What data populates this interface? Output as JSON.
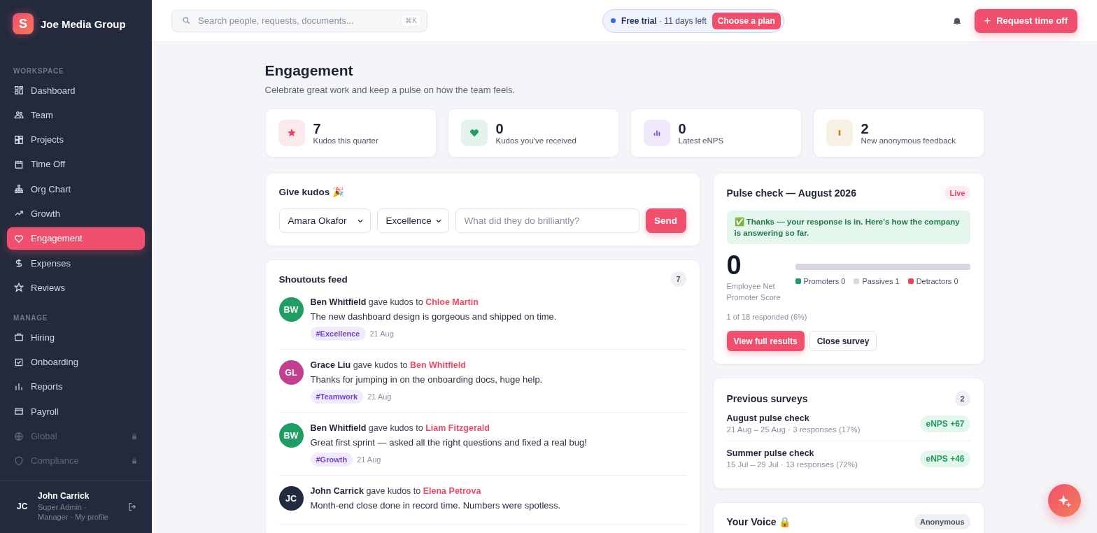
{
  "brand": {
    "logo": "S",
    "name": "Joe Media Group"
  },
  "sidebar": {
    "sections": [
      {
        "title": "WORKSPACE",
        "items": [
          {
            "label": "Dashboard",
            "selected": false,
            "locked": false
          },
          {
            "label": "Team",
            "selected": false,
            "locked": false
          },
          {
            "label": "Projects",
            "selected": false,
            "locked": false
          },
          {
            "label": "Time Off",
            "selected": false,
            "locked": false
          },
          {
            "label": "Org Chart",
            "selected": false,
            "locked": false
          },
          {
            "label": "Growth",
            "selected": false,
            "locked": false
          },
          {
            "label": "Engagement",
            "selected": true,
            "locked": false
          },
          {
            "label": "Expenses",
            "selected": false,
            "locked": false
          },
          {
            "label": "Reviews",
            "selected": false,
            "locked": false
          }
        ]
      },
      {
        "title": "MANAGE",
        "items": [
          {
            "label": "Hiring",
            "selected": false,
            "locked": false
          },
          {
            "label": "Onboarding",
            "selected": false,
            "locked": false
          },
          {
            "label": "Reports",
            "selected": false,
            "locked": false
          },
          {
            "label": "Payroll",
            "selected": false,
            "locked": false
          },
          {
            "label": "Global",
            "selected": false,
            "locked": true
          },
          {
            "label": "Compliance",
            "selected": false,
            "locked": true
          }
        ]
      }
    ],
    "user": {
      "initials": "JC",
      "name": "John Carrick",
      "role": "Super Admin ·",
      "role_2": "Manager · My profile"
    }
  },
  "topbar": {
    "search": {
      "placeholder": "Search people, requests, documents...",
      "shortcut": "⌘K"
    },
    "trial": {
      "label": "Free trial",
      "detail": "· 11 days left",
      "button": "Choose a plan"
    },
    "primary_icon": "+",
    "primary_button": "Request time off"
  },
  "page": {
    "title": "Engagement",
    "subtitle": "Celebrate great work and keep a pulse on how the team feels."
  },
  "stats": [
    {
      "value": "7",
      "label": "Kudos this quarter",
      "color": "#e8475f"
    },
    {
      "value": "0",
      "label": "Kudos you've received",
      "color": "#1f9d62"
    },
    {
      "value": "0",
      "label": "Latest eNPS",
      "color": "#7c4ddb"
    },
    {
      "value": "2",
      "label": "New anonymous feedback",
      "color": "#c9850e"
    }
  ],
  "give_kudos": {
    "title": "Give kudos 🎉",
    "person": "Amara Okafor",
    "value": "Excellence",
    "placeholder": "What did they do brilliantly?",
    "button": "Send"
  },
  "feed": {
    "title": "Shoutouts feed",
    "count": "7",
    "items": [
      {
        "initials": "BW",
        "color": "#1f9d62",
        "text": "**Ben Whitfield** gave kudos to",
        "to": "Chloe Martin",
        "message": "The new dashboard design is gorgeous and shipped on time.",
        "tag": "#Excellence",
        "date": "21 Aug"
      },
      {
        "initials": "GL",
        "color": "#c2408f",
        "text": "**Grace Liu** gave kudos to",
        "to": "Ben Whitfield",
        "message": "Thanks for jumping in on the onboarding docs, huge help.",
        "tag": "#Teamwork",
        "date": "21 Aug"
      },
      {
        "initials": "BW",
        "color": "#1f9d62",
        "text": "**Ben Whitfield** gave kudos to",
        "to": "Liam Fitzgerald",
        "message": "Great first sprint — asked all the right questions and fixed a real bug!",
        "tag": "#Growth",
        "date": "21 Aug"
      },
      {
        "initials": "JC",
        "color": "#222a3d",
        "text": "**John Carrick** gave kudos to",
        "to": "Elena Petrova",
        "message": "Month-end close done in record time. Numbers were spotless."
      }
    ]
  },
  "pulse": {
    "title": "Pulse check — August 2026",
    "badge": "Live",
    "notice": "✅ Thanks — your response is in. Here's how the company is answering so far.",
    "score": "0",
    "score_label": "Employee Net Promoter Score",
    "legend": [
      {
        "label": "Promoters 0",
        "color": "#1f9d62",
        "level": 0
      },
      {
        "label": "Passives 1",
        "color": "#d5d8e0",
        "level": 1
      },
      {
        "label": "Detractors 0",
        "color": "#e8475f",
        "level": 0
      }
    ],
    "responded": "1 of 18 responded (6%)",
    "buttons": [
      "View full results",
      "Close survey"
    ]
  },
  "previous": {
    "title": "Previous surveys",
    "count": "2",
    "items": [
      {
        "name": "August pulse check",
        "detail": "21 Aug – 25 Aug · 3 responses (17%)",
        "score": "eNPS +67"
      },
      {
        "name": "Summer pulse check",
        "detail": "15 Jul – 29 Jul · 13 responses (72%)",
        "score": "eNPS +46"
      }
    ]
  },
  "voice": {
    "title": "Your Voice 🔒",
    "badge": "Anonymous"
  }
}
